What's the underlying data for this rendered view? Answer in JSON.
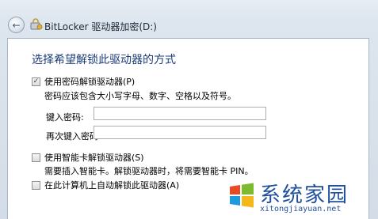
{
  "window": {
    "title": "BitLocker 驱动器加密(D:)"
  },
  "content": {
    "heading": "选择希望解锁此驱动器的方式",
    "password_option": {
      "label": "使用密码解锁驱动器(P)",
      "checked": true,
      "note": "密码应该包含大小写字母、数字、空格以及符号。",
      "enter_label": "键入密码:",
      "enter_value": "",
      "reenter_label": "再次键入密码:",
      "reenter_value": ""
    },
    "smartcard_option": {
      "label": "使用智能卡解锁驱动器(S)",
      "checked": false,
      "note": "需要插入智能卡。解锁驱动器时，将需要智能卡 PIN。"
    },
    "auto_option": {
      "label": "在此计算机上自动解锁此驱动器(A)",
      "checked": false
    }
  },
  "watermark": {
    "title": "系统家园",
    "url": "xitongjiayuan.net"
  },
  "icons": {
    "back": "back-arrow-icon",
    "app": "bitlocker-icon",
    "check": "checkmark-icon",
    "logo": "windows-logo-icon"
  },
  "colors": {
    "heading": "#1a3c7a",
    "watermark": "#1f4f9c"
  }
}
